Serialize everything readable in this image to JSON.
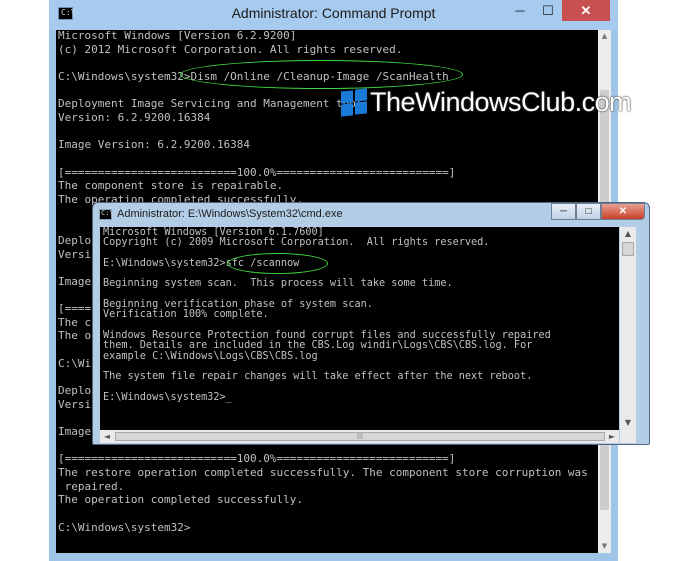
{
  "window_main": {
    "title": "Administrator: Command Prompt",
    "icon_glyph": "C:\\",
    "controls": {
      "minimize": "─",
      "maximize": "☐",
      "close": "✕"
    },
    "console_text": "Microsoft Windows [Version 6.2.9200]\n(c) 2012 Microsoft Corporation. All rights reserved.\n\nC:\\Windows\\system32>Dism /Online /Cleanup-Image /ScanHealth\n\nDeployment Image Servicing and Management tool\nVersion: 6.2.9200.16384\n\nImage Version: 6.2.9200.16384\n\n[==========================100.0%==========================]\nThe component store is repairable.\nThe operation completed successfully.\n\n\nDeplo\nVersi\n\nImage\n\n[====\nThe c\nThe o\n\nC:\\Wi\n\nDeplo\nVersi\n\nImage\n\n[==========================100.0%==========================]\nThe restore operation completed successfully. The component store corruption was\n repaired.\nThe operation completed successfully.\n\nC:\\Windows\\system32>"
  },
  "window_secondary": {
    "title": "Administrator: E:\\Windows\\System32\\cmd.exe",
    "icon_glyph": "C:\\",
    "controls": {
      "minimize": "─",
      "maximize": "□",
      "close": "✕"
    },
    "console_text": "Microsoft Windows [Version 6.1.7600]\nCopyright (c) 2009 Microsoft Corporation.  All rights reserved.\n\nE:\\Windows\\system32>sfc /scannow\n\nBeginning system scan.  This process will take some time.\n\nBeginning verification phase of system scan.\nVerification 100% complete.\n\nWindows Resource Protection found corrupt files and successfully repaired\nthem. Details are included in the CBS.Log windir\\Logs\\CBS\\CBS.log. For\nexample C:\\Windows\\Logs\\CBS\\CBS.log\n\nThe system file repair changes will take effect after the next reboot.\n\nE:\\Windows\\system32>_"
  },
  "watermark": {
    "text": "TheWindowsClub.com",
    "logo_color": "#1a7ad8"
  },
  "highlight_color": "#3fdc3f",
  "scroll_glyphs": {
    "up": "▲",
    "down": "▼",
    "left": "◄",
    "right": "►",
    "grip": "|||"
  }
}
